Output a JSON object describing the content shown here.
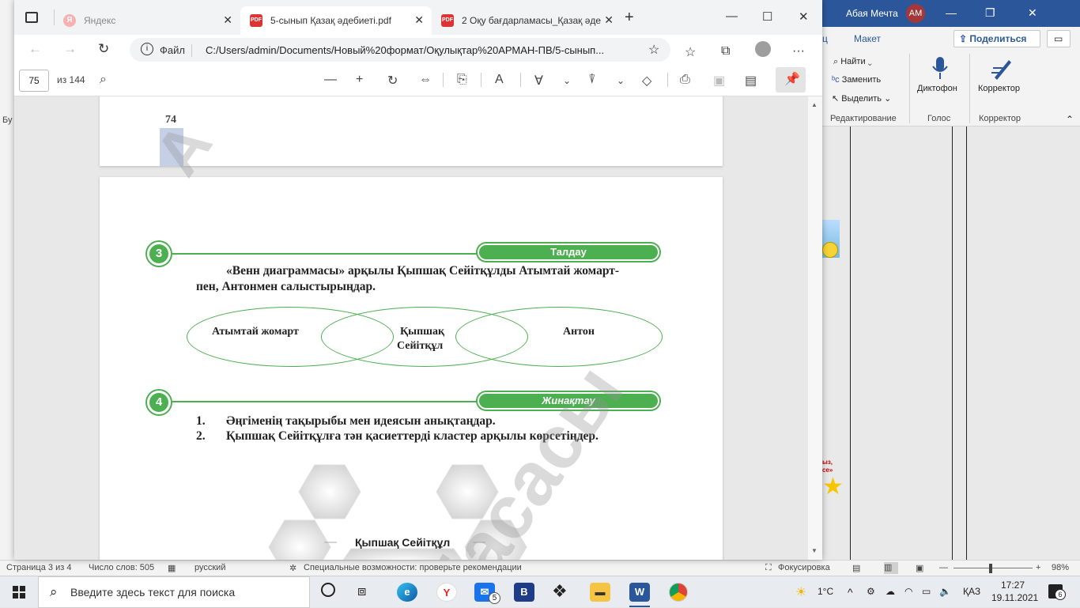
{
  "word": {
    "user_name": "Абая Мечта",
    "user_initials": "АМ",
    "tabs": [
      "ц",
      "Макет"
    ],
    "share_label": "Поделиться",
    "find_label": "Найти",
    "replace_label": "Заменить",
    "select_label": "Выделить",
    "dictation_label": "Диктофон",
    "editor_label": "Корректор",
    "group_editing": "Редактирование",
    "group_voice": "Голос",
    "group_editor": "Корректор",
    "left_edge_label": "Бу",
    "side_snip1": "ыз,",
    "side_snip2": "се»",
    "status": {
      "page": "Страница 3 из 4",
      "words": "Число слов: 505",
      "language": "русский",
      "accessibility": "Специальные возможности: проверьте рекомендации",
      "focus": "Фокусировка",
      "zoom": "98%"
    }
  },
  "browser": {
    "tabs": [
      {
        "label": "Яндекс",
        "active": false
      },
      {
        "label": "5-сынып Қазақ әдебиеті.pdf",
        "active": true
      },
      {
        "label": "2 Оқу бағдарламасы_Қазақ әде",
        "active": false
      }
    ],
    "new_tab": "+",
    "address": {
      "scheme_label": "Файл",
      "url": "C:/Users/admin/Documents/Новый%20формат/Оқулықтар%20АРМАН-ПВ/5-сынып..."
    },
    "pdf_toolbar": {
      "current_page": "75",
      "total_pages": "из 144"
    }
  },
  "pdf": {
    "prev_page_number": "74",
    "section3": {
      "number": "3",
      "badge": "Талдау",
      "text_line1": "«Венн диаграммасы» арқылы Қыпшақ Сейітқұлды Атымтай жомарт-",
      "text_line2": "пен, Антонмен салыстырыңдар.",
      "venn_left": "Атымтай жомарт",
      "venn_center_line1": "Қыпшақ",
      "venn_center_line2": "Сейітқұл",
      "venn_right": "Антон"
    },
    "section4": {
      "number": "4",
      "badge": "Жинақтау",
      "items": [
        {
          "num": "1.",
          "text": "Әңгіменің тақырыбы мен идеясын анықтаңдар."
        },
        {
          "num": "2.",
          "text": "Қыпшақ Сейітқұлға тән қасиеттерді кластер арқылы көрсетіңдер."
        }
      ]
    },
    "cluster_center": "Қыпшақ Сейітқұл",
    "watermark": "басасы"
  },
  "taskbar": {
    "search_placeholder": "Введите здесь текст для поиска",
    "mail_badge": "5",
    "temperature": "1°C",
    "language": "ҚАЗ",
    "time": "17:27",
    "date": "19.11.2021",
    "notif_count": "6"
  }
}
